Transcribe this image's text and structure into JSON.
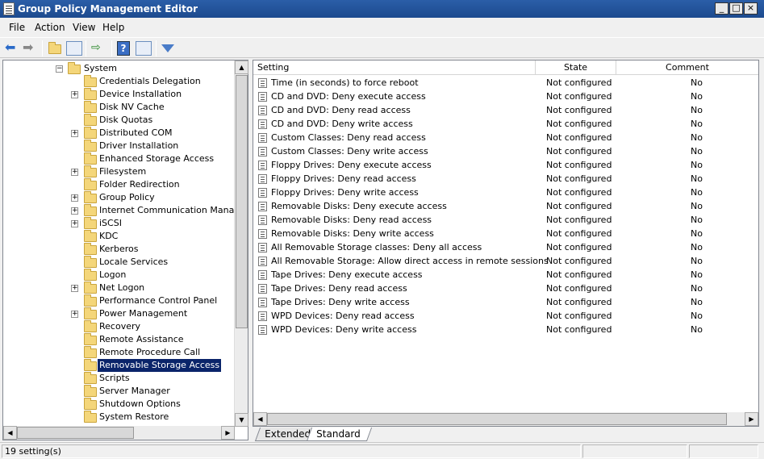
{
  "window": {
    "title": "Group Policy Management Editor",
    "buttons": [
      "_",
      "□",
      "×"
    ]
  },
  "menu": [
    "File",
    "Action",
    "View",
    "Help"
  ],
  "toolbar": {
    "buttons": [
      "back-arrow-icon",
      "forward-arrow-icon",
      "up-folder-icon",
      "show-hide-tree-icon",
      "export-list-icon",
      "help-icon",
      "properties-icon",
      "filter-icon"
    ]
  },
  "tree": {
    "parent": "System",
    "items": [
      {
        "label": "Credentials Delegation",
        "expandable": false
      },
      {
        "label": "Device Installation",
        "expandable": true
      },
      {
        "label": "Disk NV Cache",
        "expandable": false
      },
      {
        "label": "Disk Quotas",
        "expandable": false
      },
      {
        "label": "Distributed COM",
        "expandable": true
      },
      {
        "label": "Driver Installation",
        "expandable": false
      },
      {
        "label": "Enhanced Storage Access",
        "expandable": false
      },
      {
        "label": "Filesystem",
        "expandable": true
      },
      {
        "label": "Folder Redirection",
        "expandable": false
      },
      {
        "label": "Group Policy",
        "expandable": true
      },
      {
        "label": "Internet Communication Manageme",
        "expandable": true
      },
      {
        "label": "iSCSI",
        "expandable": true
      },
      {
        "label": "KDC",
        "expandable": false
      },
      {
        "label": "Kerberos",
        "expandable": false
      },
      {
        "label": "Locale Services",
        "expandable": false
      },
      {
        "label": "Logon",
        "expandable": false
      },
      {
        "label": "Net Logon",
        "expandable": true
      },
      {
        "label": "Performance Control Panel",
        "expandable": false
      },
      {
        "label": "Power Management",
        "expandable": true
      },
      {
        "label": "Recovery",
        "expandable": false
      },
      {
        "label": "Remote Assistance",
        "expandable": false
      },
      {
        "label": "Remote Procedure Call",
        "expandable": false
      },
      {
        "label": "Removable Storage Access",
        "expandable": false,
        "selected": true
      },
      {
        "label": "Scripts",
        "expandable": false
      },
      {
        "label": "Server Manager",
        "expandable": false
      },
      {
        "label": "Shutdown Options",
        "expandable": false
      },
      {
        "label": "System Restore",
        "expandable": false
      }
    ]
  },
  "list": {
    "columns": [
      "Setting",
      "State",
      "Comment"
    ],
    "rows": [
      {
        "setting": "Time (in seconds) to force reboot",
        "state": "Not configured",
        "comment": "No"
      },
      {
        "setting": "CD and DVD: Deny execute access",
        "state": "Not configured",
        "comment": "No"
      },
      {
        "setting": "CD and DVD: Deny read access",
        "state": "Not configured",
        "comment": "No"
      },
      {
        "setting": "CD and DVD: Deny write access",
        "state": "Not configured",
        "comment": "No"
      },
      {
        "setting": "Custom Classes: Deny read access",
        "state": "Not configured",
        "comment": "No"
      },
      {
        "setting": "Custom Classes: Deny write access",
        "state": "Not configured",
        "comment": "No"
      },
      {
        "setting": "Floppy Drives: Deny execute access",
        "state": "Not configured",
        "comment": "No"
      },
      {
        "setting": "Floppy Drives: Deny read access",
        "state": "Not configured",
        "comment": "No"
      },
      {
        "setting": "Floppy Drives: Deny write access",
        "state": "Not configured",
        "comment": "No"
      },
      {
        "setting": "Removable Disks: Deny execute access",
        "state": "Not configured",
        "comment": "No"
      },
      {
        "setting": "Removable Disks: Deny read access",
        "state": "Not configured",
        "comment": "No"
      },
      {
        "setting": "Removable Disks: Deny write access",
        "state": "Not configured",
        "comment": "No"
      },
      {
        "setting": "All Removable Storage classes: Deny all access",
        "state": "Not configured",
        "comment": "No"
      },
      {
        "setting": "All Removable Storage: Allow direct access in remote sessions",
        "state": "Not configured",
        "comment": "No"
      },
      {
        "setting": "Tape Drives: Deny execute access",
        "state": "Not configured",
        "comment": "No"
      },
      {
        "setting": "Tape Drives: Deny read access",
        "state": "Not configured",
        "comment": "No"
      },
      {
        "setting": "Tape Drives: Deny write access",
        "state": "Not configured",
        "comment": "No"
      },
      {
        "setting": "WPD Devices: Deny read access",
        "state": "Not configured",
        "comment": "No"
      },
      {
        "setting": "WPD Devices: Deny write access",
        "state": "Not configured",
        "comment": "No"
      }
    ]
  },
  "tabs": [
    {
      "label": "Extended",
      "active": false
    },
    {
      "label": "Standard",
      "active": true
    }
  ],
  "status": {
    "text": "19 setting(s)"
  }
}
